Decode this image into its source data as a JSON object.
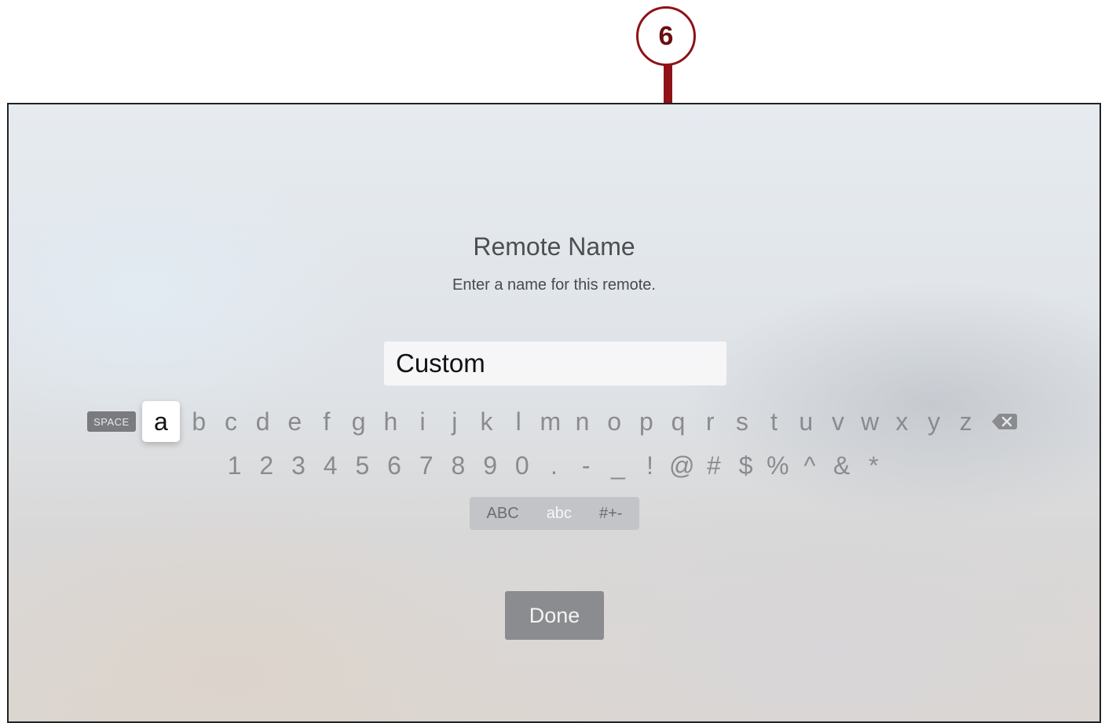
{
  "callout": {
    "number": "6"
  },
  "dialog": {
    "title": "Remote Name",
    "subtitle": "Enter a name for this remote.",
    "name_field": {
      "value": "Custom"
    }
  },
  "keyboard": {
    "space_label": "SPACE",
    "letters": [
      "a",
      "b",
      "c",
      "d",
      "e",
      "f",
      "g",
      "h",
      "i",
      "j",
      "k",
      "l",
      "m",
      "n",
      "o",
      "p",
      "q",
      "r",
      "s",
      "t",
      "u",
      "v",
      "w",
      "x",
      "y",
      "z"
    ],
    "focused_key": "a",
    "delete_icon": "backspace-icon",
    "symbols": [
      "1",
      "2",
      "3",
      "4",
      "5",
      "6",
      "7",
      "8",
      "9",
      "0",
      ".",
      "-",
      "_",
      "!",
      "@",
      "#",
      "$",
      "%",
      "^",
      "&",
      "*"
    ],
    "modes": [
      "ABC",
      "abc",
      "#+-"
    ],
    "active_mode": "abc"
  },
  "done_button": {
    "label": "Done"
  },
  "colors": {
    "callout": "#8f1218",
    "focused_key_bg": "#ffffff",
    "done_button_bg": "#8b8c8f"
  }
}
